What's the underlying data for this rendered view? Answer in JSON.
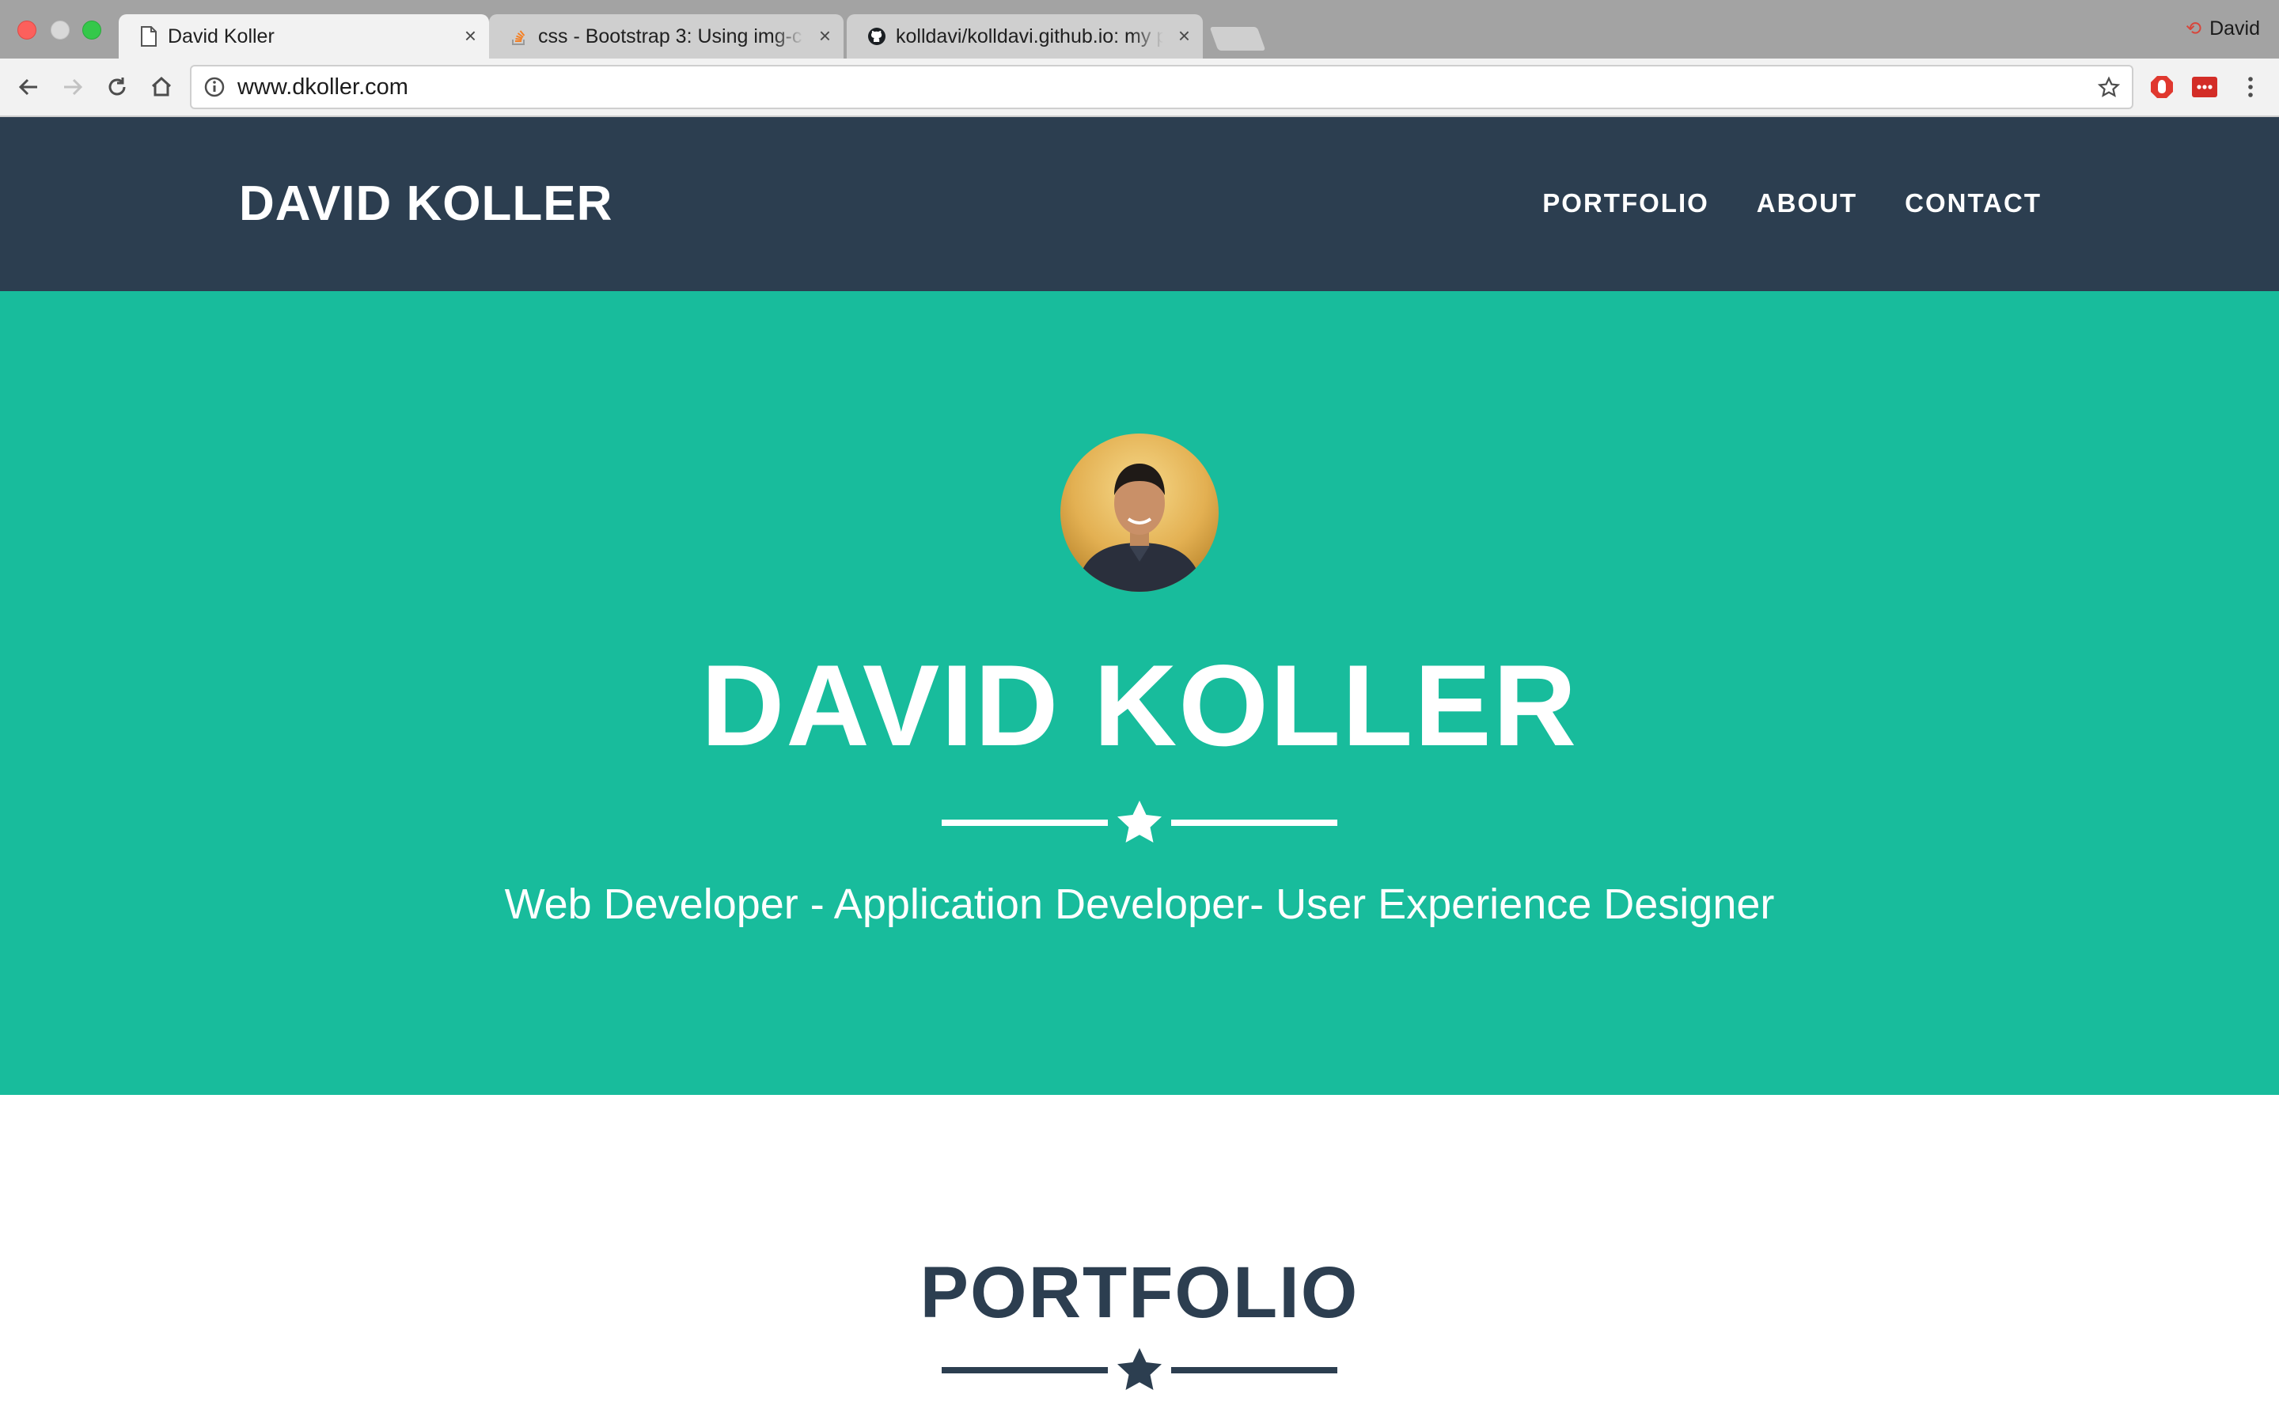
{
  "browser": {
    "tabs": [
      {
        "title": "David Koller",
        "favicon": "page-icon",
        "active": true
      },
      {
        "title": "css - Bootstrap 3: Using img-c",
        "favicon": "stackoverflow-icon",
        "active": false
      },
      {
        "title": "kolldavi/kolldavi.github.io: my p",
        "favicon": "github-icon",
        "active": false
      }
    ],
    "profile_name": "David",
    "url": "www.dkoller.com",
    "colors": {
      "tabstrip": "#a3a3a3",
      "toolbar": "#f2f2f2"
    }
  },
  "site": {
    "brand": "DAVID KOLLER",
    "nav": [
      "PORTFOLIO",
      "ABOUT",
      "CONTACT"
    ],
    "hero": {
      "name": "DAVID KOLLER",
      "tagline": "Web Developer - Application Developer- User Experience Designer"
    },
    "section_title": "PORTFOLIO",
    "colors": {
      "navbar": "#2c3e50",
      "hero": "#18bc9c",
      "text_dark": "#2c3e50"
    }
  }
}
